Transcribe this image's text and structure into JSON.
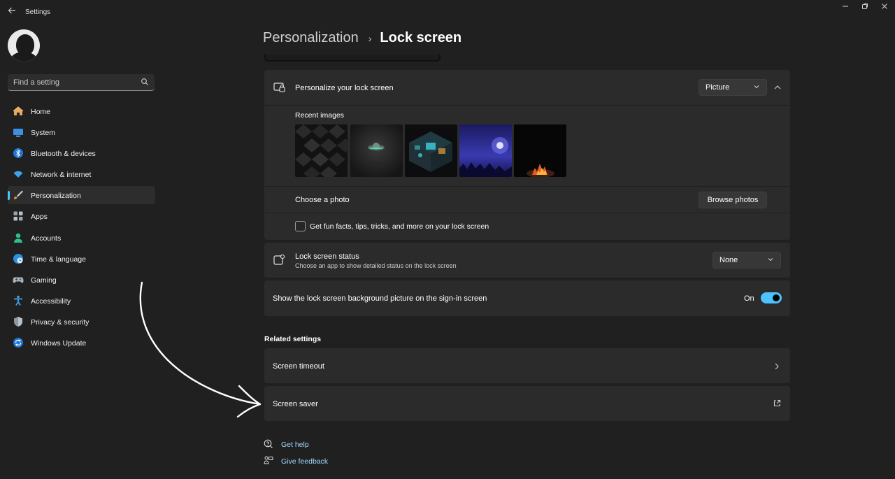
{
  "window": {
    "title": "Settings"
  },
  "search": {
    "placeholder": "Find a setting"
  },
  "sidebar": {
    "items": [
      {
        "label": "Home"
      },
      {
        "label": "System"
      },
      {
        "label": "Bluetooth & devices"
      },
      {
        "label": "Network & internet"
      },
      {
        "label": "Personalization"
      },
      {
        "label": "Apps"
      },
      {
        "label": "Accounts"
      },
      {
        "label": "Time & language"
      },
      {
        "label": "Gaming"
      },
      {
        "label": "Accessibility"
      },
      {
        "label": "Privacy & security"
      },
      {
        "label": "Windows Update"
      }
    ],
    "active_index": 4
  },
  "breadcrumb": {
    "parent": "Personalization",
    "separator": "›",
    "current": "Lock screen"
  },
  "personalize": {
    "title": "Personalize your lock screen",
    "dropdown_value": "Picture",
    "recent_images_label": "Recent images",
    "choose_photo_label": "Choose a photo",
    "browse_button": "Browse photos",
    "fun_facts_label": "Get fun facts, tips, tricks, and more on your lock screen",
    "fun_facts_checked": false
  },
  "status": {
    "title": "Lock screen status",
    "subtitle": "Choose an app to show detailed status on the lock screen",
    "dropdown_value": "None"
  },
  "signin": {
    "label": "Show the lock screen background picture on the sign-in screen",
    "toggle_label": "On",
    "enabled": true
  },
  "related": {
    "heading": "Related settings",
    "items": [
      {
        "label": "Screen timeout"
      },
      {
        "label": "Screen saver"
      }
    ]
  },
  "help": {
    "get_help": "Get help",
    "give_feedback": "Give feedback"
  },
  "colors": {
    "accent": "#4cc2ff",
    "background": "#202020",
    "card": "#2b2b2b",
    "link": "#9fd8ff"
  }
}
